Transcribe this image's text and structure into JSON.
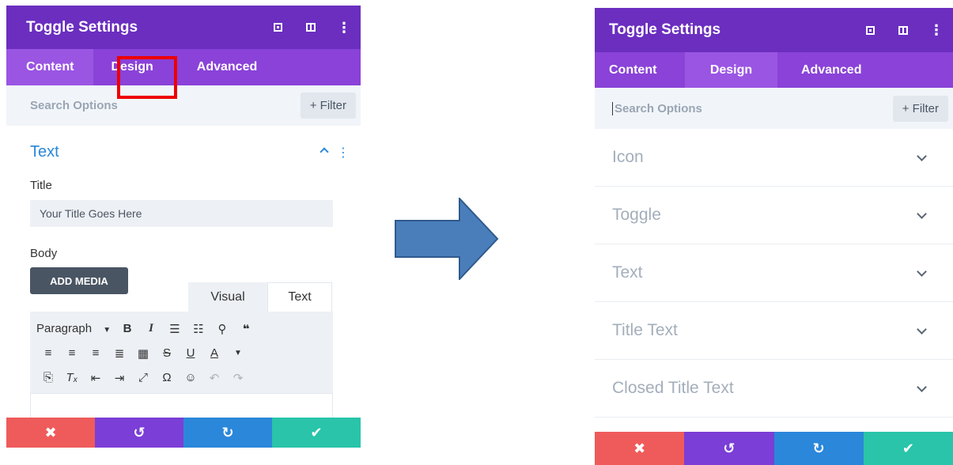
{
  "left_panel": {
    "title": "Toggle Settings",
    "tabs": [
      "Content",
      "Design",
      "Advanced"
    ],
    "search_placeholder": "Search Options",
    "filter_label": "+ Filter",
    "section_title": "Text",
    "title_label": "Title",
    "title_value": "Your Title Goes Here",
    "body_label": "Body",
    "add_media_label": "ADD MEDIA",
    "editor_tabs": [
      "Visual",
      "Text"
    ],
    "format_select": "Paragraph"
  },
  "right_panel": {
    "title": "Toggle Settings",
    "tabs": [
      "Content",
      "Design",
      "Advanced"
    ],
    "search_placeholder": "Search Options",
    "filter_label": "+ Filter",
    "groups": [
      "Icon",
      "Toggle",
      "Text",
      "Title Text",
      "Closed Title Text"
    ]
  },
  "colors": {
    "header": "#6b2ebf",
    "tabs": "#8a42d8",
    "accent": "#2b87da",
    "cancel": "#ef5b5b",
    "undo": "#7b3ed6",
    "redo": "#2b87da",
    "save": "#29c4a9",
    "highlight": "#ee0000",
    "arrow": "#4a7ebb"
  },
  "icons": {
    "header": [
      "expand-icon",
      "split-view-icon",
      "more-options-icon"
    ],
    "footer": [
      "close-icon",
      "undo-icon",
      "redo-icon",
      "check-icon"
    ]
  }
}
